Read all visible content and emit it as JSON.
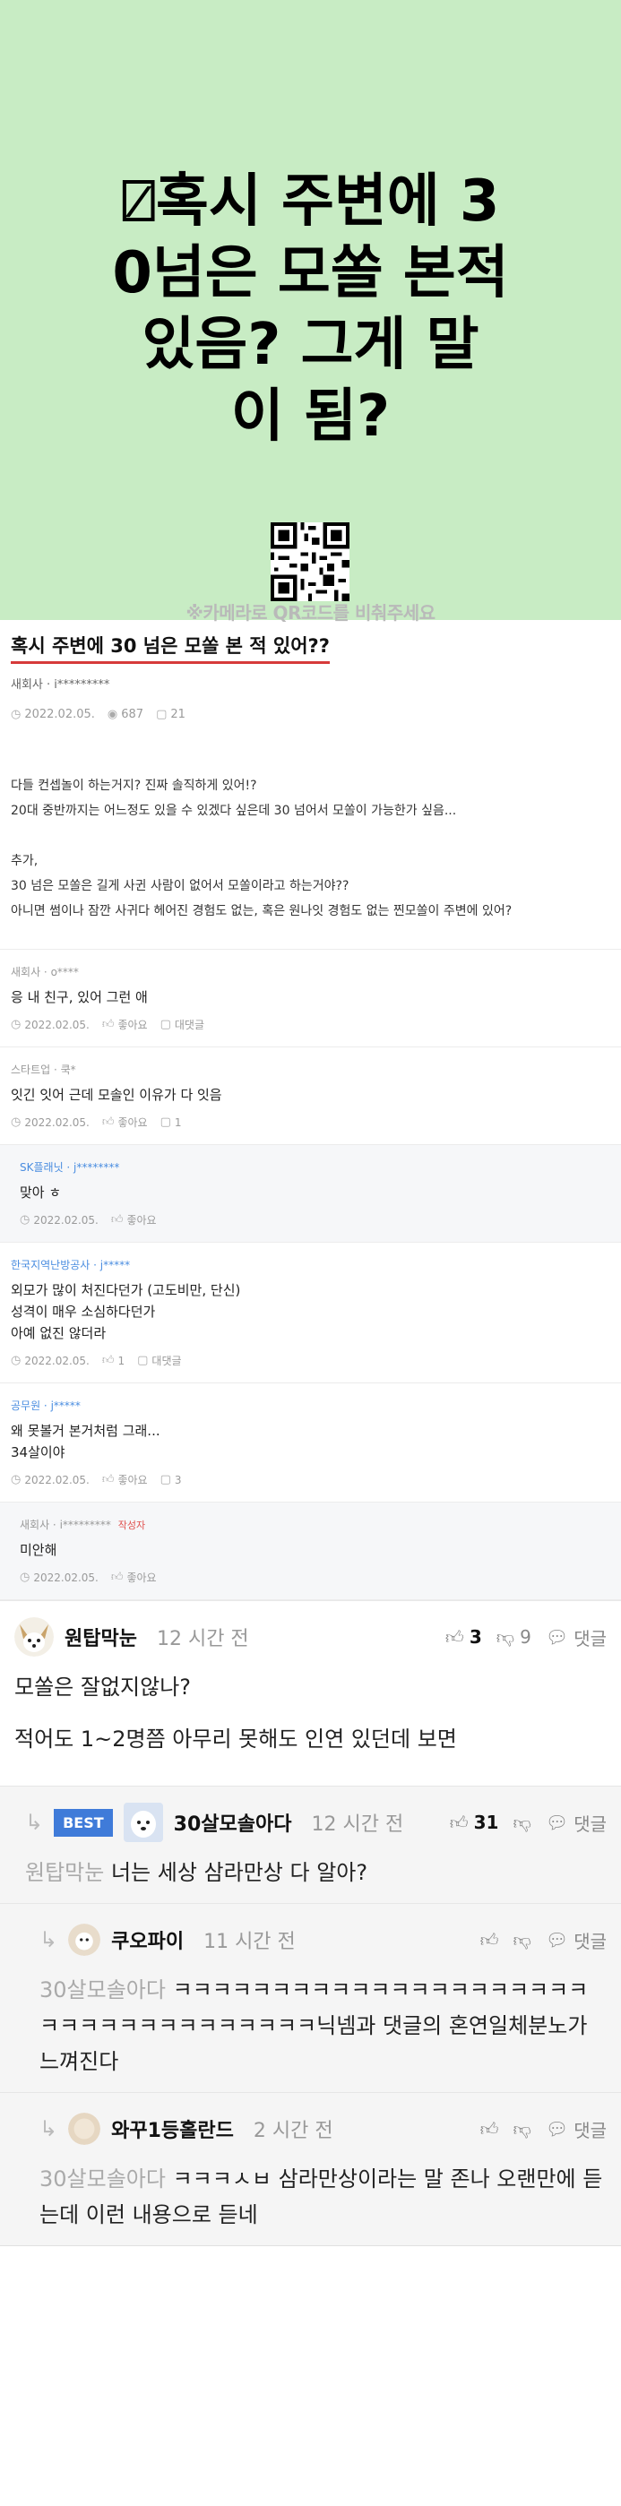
{
  "banner": {
    "title_lines": [
      "⍁혹시 주변에 3",
      "0넘은 모쏠 본적",
      "있음? 그게 말",
      "이 됨?"
    ],
    "qr_caption": "※카메라로 QR코드를 비춰주세요"
  },
  "post": {
    "title": "혹시 주변에 30 넘은 모쏠 본 적 있어??",
    "author": "새회사 · i*********",
    "date": "2022.02.05.",
    "views": "687",
    "comments": "21",
    "body": [
      "다들 컨셉놀이 하는거지? 진짜 솔직하게 있어!?",
      "20대 중반까지는 어느정도 있을 수 있겠다 싶은데 30 넘어서 모쏠이 가능한가 싶음...",
      "",
      "추가,",
      "30 넘은 모쏠은 길게 사귄 사람이 없어서 모쏠이라고 하는거야??",
      "아니면 썸이나 잠깐 사귀다 헤어진 경험도 없는, 혹은 원나잇 경험도 없는 찐모쏠이 주변에 있어?"
    ]
  },
  "comments": [
    {
      "author": "새회사 · o****",
      "text": [
        "응 내 친구, 있어 그런 애"
      ],
      "date": "2022.02.05.",
      "like": "좋아요",
      "reply": "대댓글"
    },
    {
      "author": "스타트업 · 쿡*",
      "text": [
        "잇긴 잇어 근데 모솔인 이유가 다 잇음"
      ],
      "date": "2022.02.05.",
      "like": "좋아요",
      "reply": "1"
    },
    {
      "author": "SK플래닛 · j********",
      "text": [
        "맞아 ㅎ"
      ],
      "date": "2022.02.05.",
      "like": "좋아요"
    },
    {
      "author": "한국지역난방공사 · j*****",
      "text": [
        "외모가 많이 처진다던가 (고도비만, 단신)",
        "성격이 매우 소심하다던가",
        "아예 없진 않더라"
      ],
      "date": "2022.02.05.",
      "like": "1",
      "reply": "대댓글"
    },
    {
      "author": "공무원 · j*****",
      "text": [
        "왜 못볼거 본거처럼 그래...",
        "34살이야"
      ],
      "date": "2022.02.05.",
      "like": "좋아요",
      "reply": "3"
    },
    {
      "author": "새회사 · i*********",
      "writer_tag": "작성자",
      "text": [
        "미안해"
      ],
      "date": "2022.02.05.",
      "like": "좋아요"
    }
  ],
  "big_comments": {
    "main": {
      "name": "원탑막눈",
      "time": "12 시간 전",
      "up": "3",
      "down": "9",
      "reply": "댓글",
      "text": [
        "모쏠은 잘없지않나?",
        "적어도 1~2명쯤 아무리 못해도 인연 있던데 보면"
      ]
    },
    "best": {
      "badge": "BEST",
      "name": "30살모솔아다",
      "time": "12 시간 전",
      "up": "31",
      "reply": "댓글",
      "mention": "원탑막눈",
      "text": "너는 세상 삼라만상 다 알아?"
    },
    "replies": [
      {
        "name": "쿠오파이",
        "time": "11 시간 전",
        "reply": "댓글",
        "mention": "30살모솔아다",
        "text": "ㅋㅋㅋㅋㅋㅋㅋㅋㅋㅋㅋㅋㅋㅋㅋㅋㅋㅋㅋㅋㅋㅋㅋㅋㅋㅋㅋㅋㅋㅋㅋㅋㅋㅋㅋ닉넴과 댓글의 혼연일체분노가 느껴진다"
      },
      {
        "name": "와꾸1등홀란드",
        "time": "2 시간 전",
        "reply": "댓글",
        "mention": "30살모솔아다",
        "text": "ㅋㅋㅋㅅㅂ 삼라만상이라는 말 존나 오랜만에 듣는데 이런 내용으로 듣네"
      }
    ]
  },
  "colors": {
    "banner_bg": "#c8ecc4",
    "title_underline": "#d63a3a",
    "best_badge": "#3f7bd9",
    "company_blue": "#4a8de0",
    "writer_red": "#e0524f"
  }
}
